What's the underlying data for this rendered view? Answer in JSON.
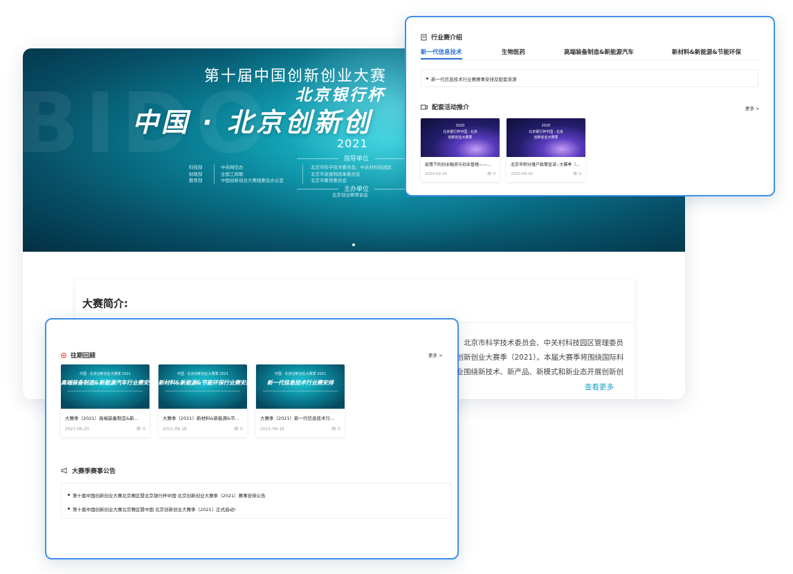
{
  "banner": {
    "watermark": "BIDO",
    "line1": "第十届中国创新创业大赛",
    "line2": "北京银行杯",
    "line3": "中国 · 北京创新创",
    "year": "2021",
    "guide_heading": "指导单位",
    "col1": [
      "科技部",
      "财政部",
      "教育部"
    ],
    "col2": [
      "中央网信办",
      "全国工商联",
      "中国创新创业大赛组委会办公室"
    ],
    "col3": [
      "北京市科学技术委员会、中关村科技园区",
      "北京市发展和改革委员会",
      "北京市教育委员会"
    ],
    "host_heading": "主办单位",
    "host": "北京创业孵育协会"
  },
  "intro": {
    "title": "大赛简介:",
    "lines": [
      "室、北京市科学技术委员会、中关村科技园区管理委员",
      "京创新创业大赛季（2021）。本届大赛季将围绕国际科",
      "企业围绕新技术、新产品、新模式和新业态开展创新创"
    ],
    "more": "查看更多"
  },
  "industry": {
    "title": "行业赛介绍",
    "tabs": [
      "新一代信息技术",
      "生物医药",
      "高端装备制造&新能源汽车",
      "新材料&新能源&节能环保"
    ],
    "active_tab": 0,
    "info_item": "新一代信息技术行业赛赛事安排及配套资源",
    "activities_title": "配套活动推介",
    "more": "更多 >",
    "activities": [
      {
        "thumb_line1": "2020",
        "thumb_line2": "北京银行杯中国 · 北京",
        "thumb_line3": "创新创业大赛季",
        "title": "疫情下的创业融资与创业管理——...",
        "date": "2020-09-25",
        "views": "0"
      },
      {
        "thumb_line1": "2020",
        "thumb_line2": "北京银行杯中国 · 北京",
        "thumb_line3": "创新创业大赛季",
        "title": "北京市积分落户政策宣讲--大赛季（...",
        "date": "2020-09-30",
        "views": "0"
      }
    ]
  },
  "review": {
    "title": "往期回顾",
    "more": "更多 >",
    "items": [
      {
        "thumb_top": "中国 · 北京创新创业大赛季 2021",
        "thumb_main": "高端装备制造&新能源汽车行业赛安排",
        "title": "大赛季（2021）高端装备制造&新...",
        "date": "2021-06-20",
        "views": "0"
      },
      {
        "thumb_top": "中国 · 北京创新创业大赛季 2021",
        "thumb_main": "新材料&新能源&节能环保行业赛安排",
        "title": "大赛季（2021）新材料&新能源&节...",
        "date": "2021-06-18",
        "views": "0"
      },
      {
        "thumb_top": "中国 · 北京创新创业大赛季 2021",
        "thumb_main": "新一代信息技术行业赛安排",
        "title": "大赛季（2021）新一代信息技术行...",
        "date": "2021-06-16",
        "views": "0"
      }
    ],
    "notices_title": "大赛季赛事公告",
    "notices": [
      "第十届中国创新创业大赛北京赛区暨北京银行杯中国·北京创新创业大赛季（2021）赛事安排公告",
      "第十届中国创新创业大赛北京赛区暨中国·北京创新创业大赛季（2021）正式启动!"
    ]
  }
}
